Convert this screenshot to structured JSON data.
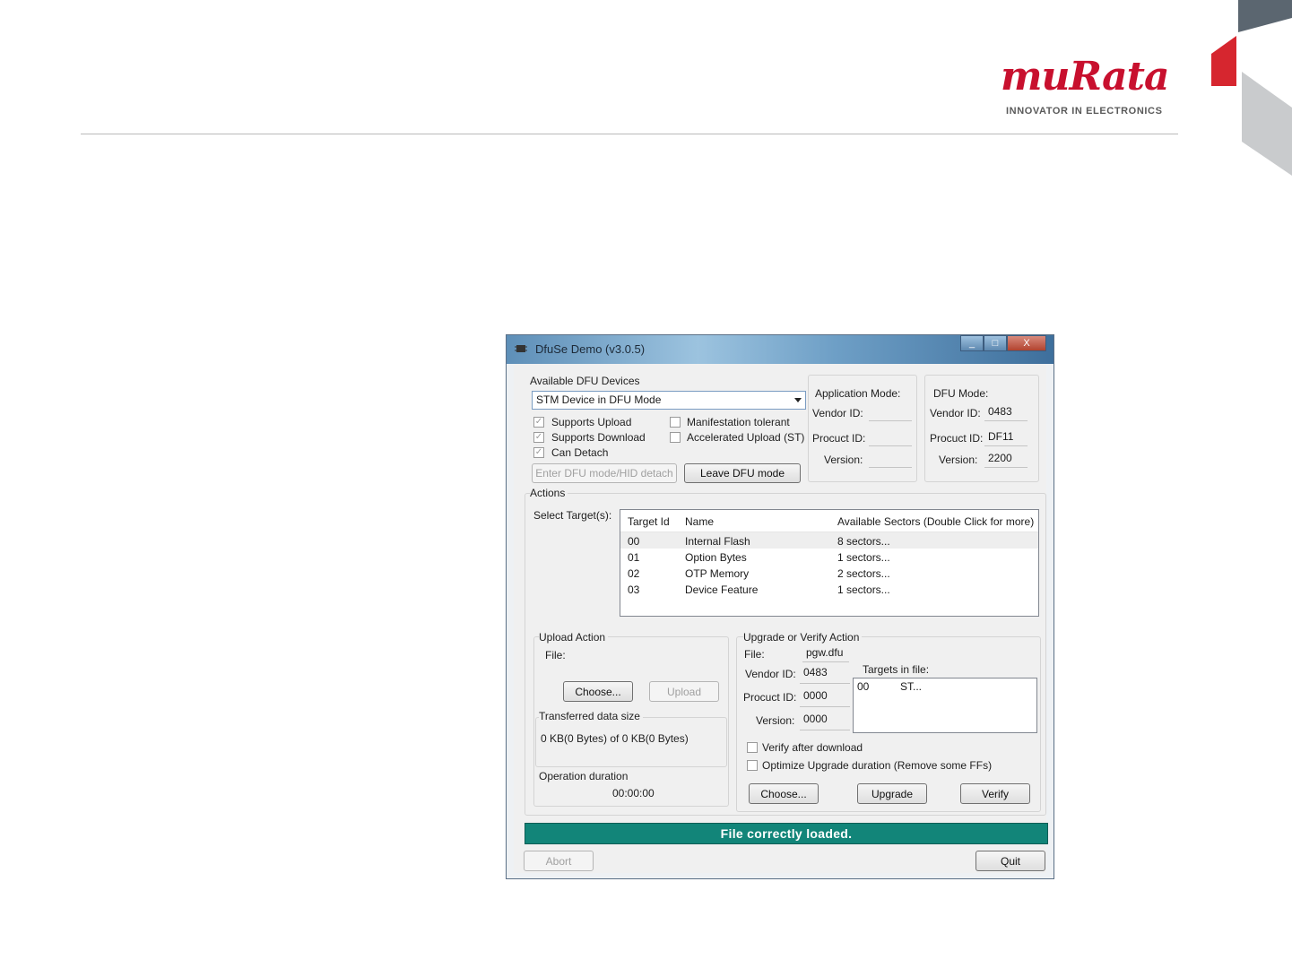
{
  "slide": {
    "logo_text": "muRata",
    "logo_tagline": "INNOVATOR IN ELECTRONICS"
  },
  "window": {
    "title": "DfuSe Demo (v3.0.5)",
    "caption_buttons": [
      "_",
      "□",
      "X"
    ]
  },
  "devices": {
    "heading": "Available DFU Devices",
    "selected": "STM Device in DFU Mode",
    "checks": [
      {
        "label": "Supports Upload",
        "checked": true
      },
      {
        "label": "Supports Download",
        "checked": true
      },
      {
        "label": "Can Detach",
        "checked": true
      },
      {
        "label": "Manifestation tolerant",
        "checked": false
      },
      {
        "label": "Accelerated Upload (ST)",
        "checked": false
      }
    ],
    "enter_dfu_label": "Enter DFU mode/HID detach",
    "leave_dfu_label": "Leave DFU mode"
  },
  "app_mode": {
    "heading": "Application Mode:",
    "vendor_label": "Vendor ID:",
    "product_label": "Procuct ID:",
    "version_label": "Version:",
    "vendor": "",
    "product": "",
    "version": ""
  },
  "dfu_mode": {
    "heading": "DFU Mode:",
    "vendor_label": "Vendor ID:",
    "product_label": "Procuct ID:",
    "version_label": "Version:",
    "vendor": "0483",
    "product": "DF11",
    "version": "2200"
  },
  "actions": {
    "heading": "Actions",
    "select_label": "Select Target(s):",
    "columns": [
      "Target Id",
      "Name",
      "Available Sectors (Double Click for more)"
    ],
    "rows": [
      [
        "00",
        "Internal Flash",
        "8 sectors..."
      ],
      [
        "01",
        "Option Bytes",
        "1 sectors..."
      ],
      [
        "02",
        "OTP Memory",
        "2 sectors..."
      ],
      [
        "03",
        "Device Feature",
        "1 sectors..."
      ]
    ]
  },
  "upload": {
    "heading": "Upload Action",
    "file_label": "File:",
    "choose_label": "Choose...",
    "upload_label": "Upload",
    "transferred_heading": "Transferred data size",
    "transferred_value": "0 KB(0 Bytes) of 0 KB(0 Bytes)",
    "duration_heading": "Operation duration",
    "duration_value": "00:00:00"
  },
  "upgrade": {
    "heading": "Upgrade or Verify Action",
    "file_label": "File:",
    "file_value": "pgw.dfu",
    "vendor_label": "Vendor ID:",
    "vendor": "0483",
    "product_label": "Procuct ID:",
    "product": "0000",
    "version_label": "Version:",
    "version": "0000",
    "targets_label": "Targets in file:",
    "targets": [
      [
        "00",
        "ST..."
      ]
    ],
    "verify_after_label": "Verify after download",
    "optimize_label": "Optimize Upgrade duration (Remove some FFs)",
    "choose_label": "Choose...",
    "upgrade_label": "Upgrade",
    "verify_label": "Verify"
  },
  "status_text": "File correctly loaded.",
  "footer": {
    "abort_label": "Abort",
    "quit_label": "Quit"
  }
}
